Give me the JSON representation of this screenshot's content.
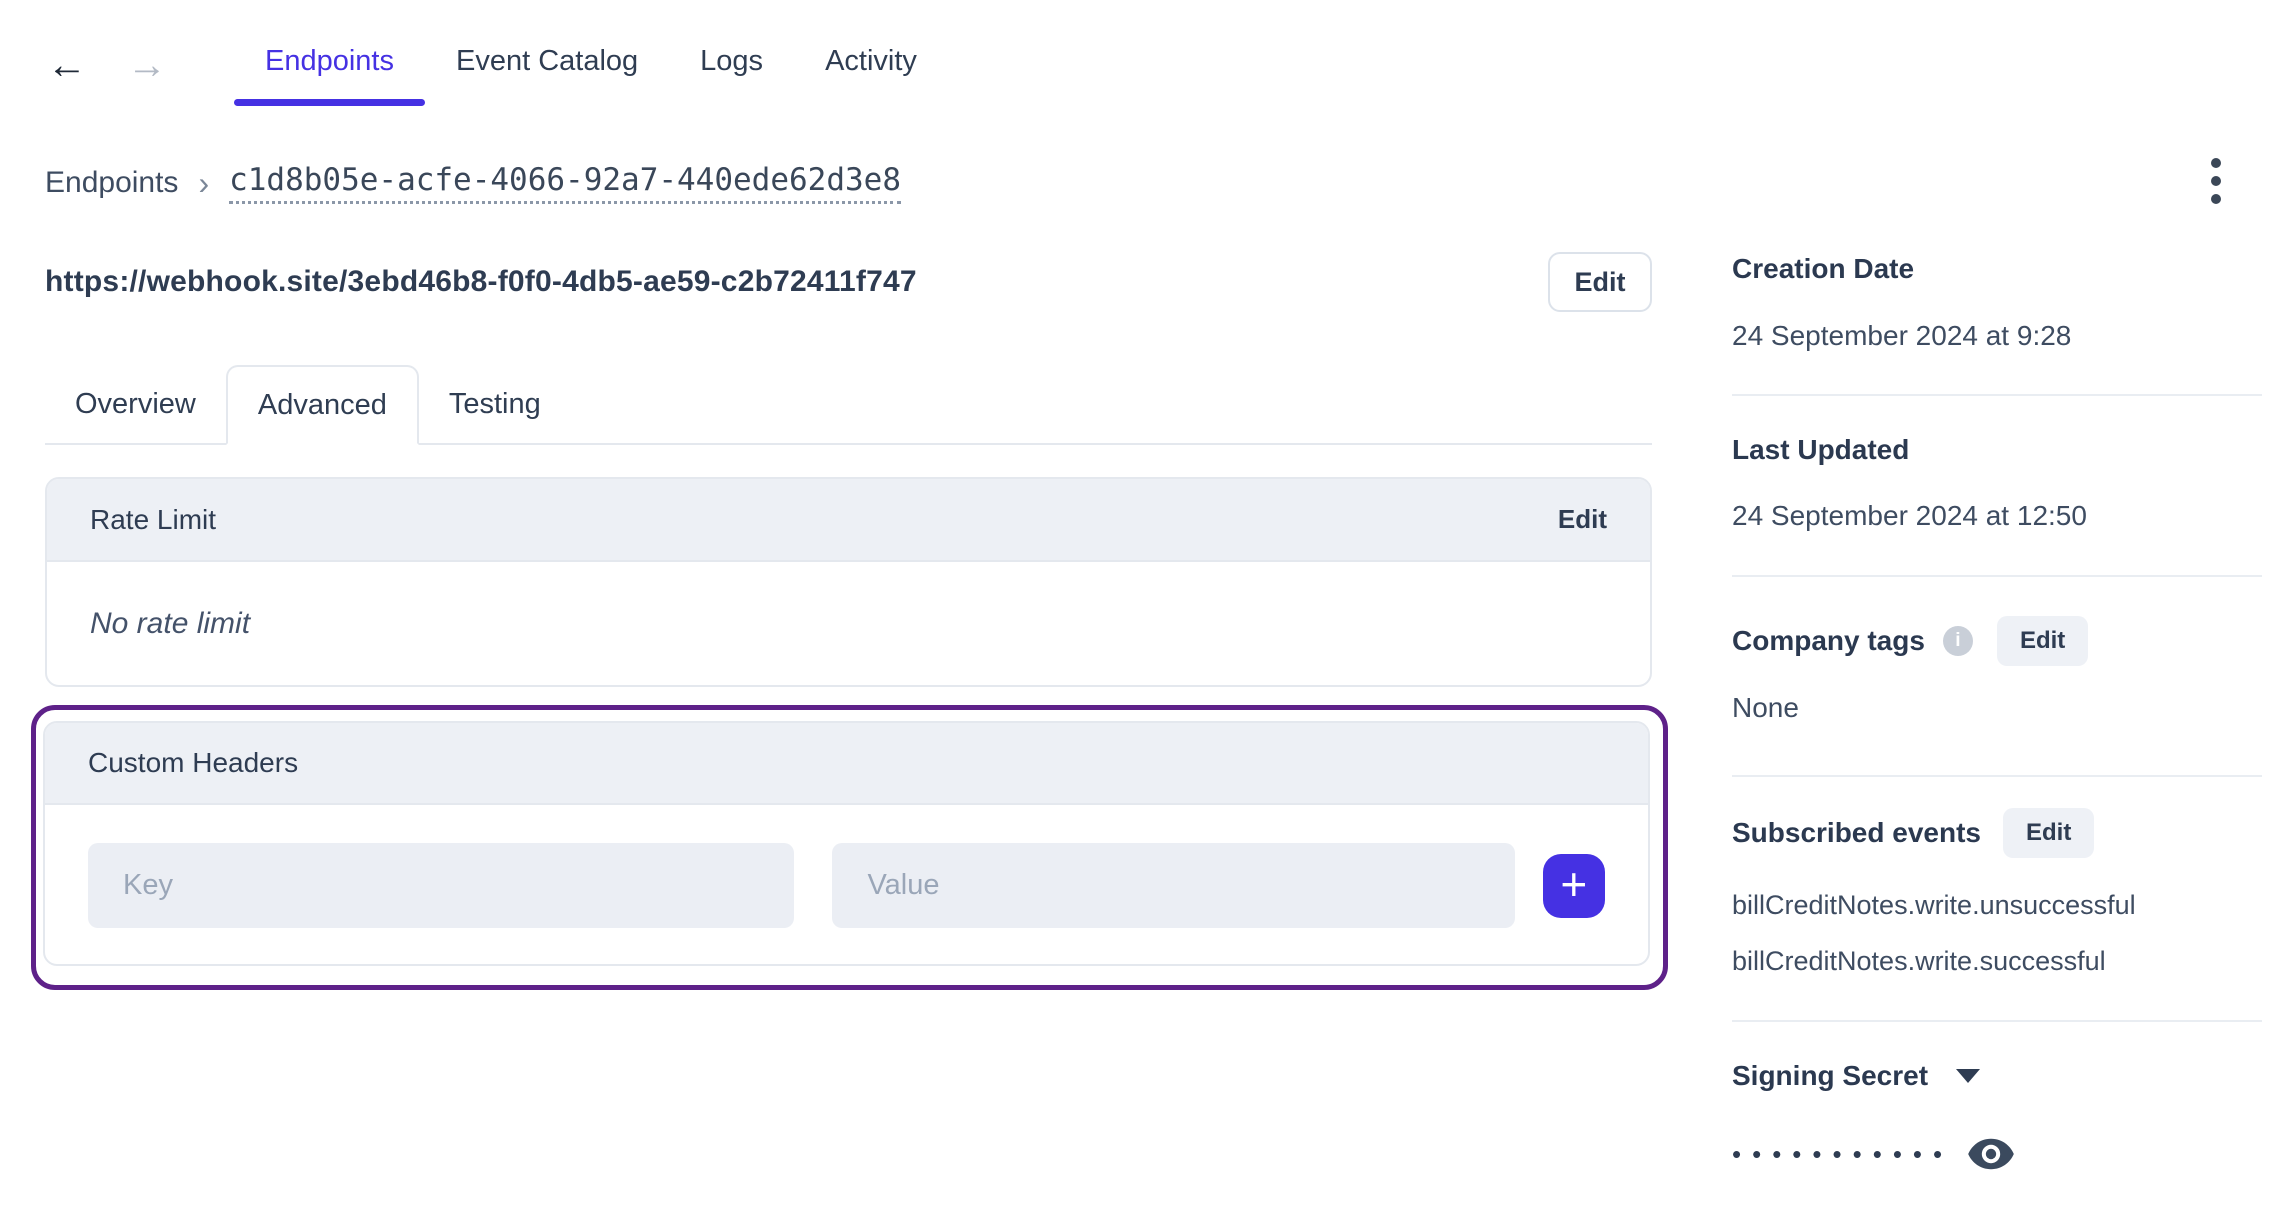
{
  "colors": {
    "accent": "#4531e3",
    "highlight_ring": "#5e2189",
    "card_header_bg": "#edf0f5",
    "text_dark": "#2e3c52"
  },
  "top_nav": {
    "back_icon": "←",
    "forward_icon": "→",
    "tabs": [
      {
        "label": "Endpoints",
        "active": true
      },
      {
        "label": "Event Catalog",
        "active": false
      },
      {
        "label": "Logs",
        "active": false
      },
      {
        "label": "Activity",
        "active": false
      }
    ]
  },
  "breadcrumb": {
    "root": "Endpoints",
    "separator": "›",
    "endpoint_id": "c1d8b05e-acfe-4066-92a7-440ede62d3e8"
  },
  "endpoint_header": {
    "url": "https://webhook.site/3ebd46b8-f0f0-4db5-ae59-c2b72411f747",
    "edit_label": "Edit"
  },
  "detail_tabs": {
    "overview": "Overview",
    "advanced": "Advanced",
    "testing": "Testing",
    "active_tab": "Advanced"
  },
  "rate_limit_card": {
    "title": "Rate Limit",
    "edit_label": "Edit",
    "empty_message": "No rate limit"
  },
  "custom_headers_card": {
    "title": "Custom Headers",
    "key_placeholder": "Key",
    "value_placeholder": "Value",
    "add_icon": "+"
  },
  "sidebar": {
    "creation_date": {
      "label": "Creation Date",
      "value": "24 September 2024 at 9:28"
    },
    "last_updated": {
      "label": "Last Updated",
      "value": "24 September 2024 at 12:50"
    },
    "company_tags": {
      "label": "Company tags",
      "info_icon": "i",
      "edit_label": "Edit",
      "value": "None"
    },
    "subscribed_events": {
      "label": "Subscribed events",
      "edit_label": "Edit",
      "events": [
        "billCreditNotes.write.unsuccessful",
        "billCreditNotes.write.successful"
      ]
    },
    "signing_secret": {
      "label": "Signing Secret",
      "masked_value": "•••••••••••"
    }
  }
}
